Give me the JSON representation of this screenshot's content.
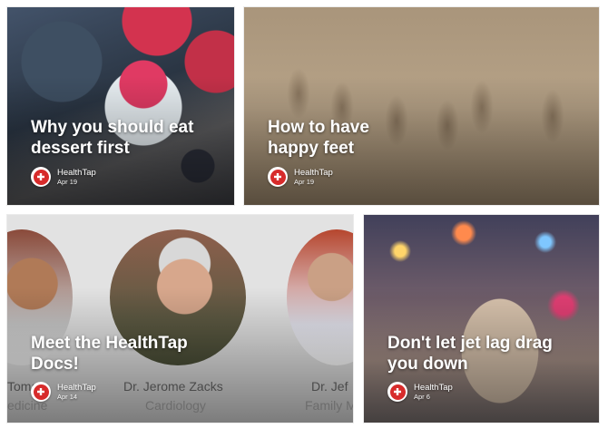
{
  "cards": [
    {
      "title": "Why you should eat\ndessert first",
      "source": "HealthTap",
      "date": "Apr 19",
      "image_icon": "desserts-photo"
    },
    {
      "title": "How to have\nhappy feet",
      "source": "HealthTap",
      "date": "Apr 19",
      "image_icon": "footprints-in-sand-photo"
    },
    {
      "title": "Meet the HealthTap\nDocs!",
      "source": "HealthTap",
      "date": "Apr 14",
      "image_icon": "doctors-photo",
      "doctors": [
        {
          "name": "Tomaly",
          "specialty": "edicine"
        },
        {
          "name": "Dr. Jerome Zacks",
          "specialty": "Cardiology"
        },
        {
          "name": "Dr. Jef",
          "specialty": "Family M"
        }
      ]
    },
    {
      "title": "Don't let jet lag drag\nyou down",
      "source": "HealthTap",
      "date": "Apr 6",
      "image_icon": "traveler-photo"
    }
  ],
  "colors": {
    "logo_red": "#d72b2b",
    "title_text": "#ffffff"
  }
}
